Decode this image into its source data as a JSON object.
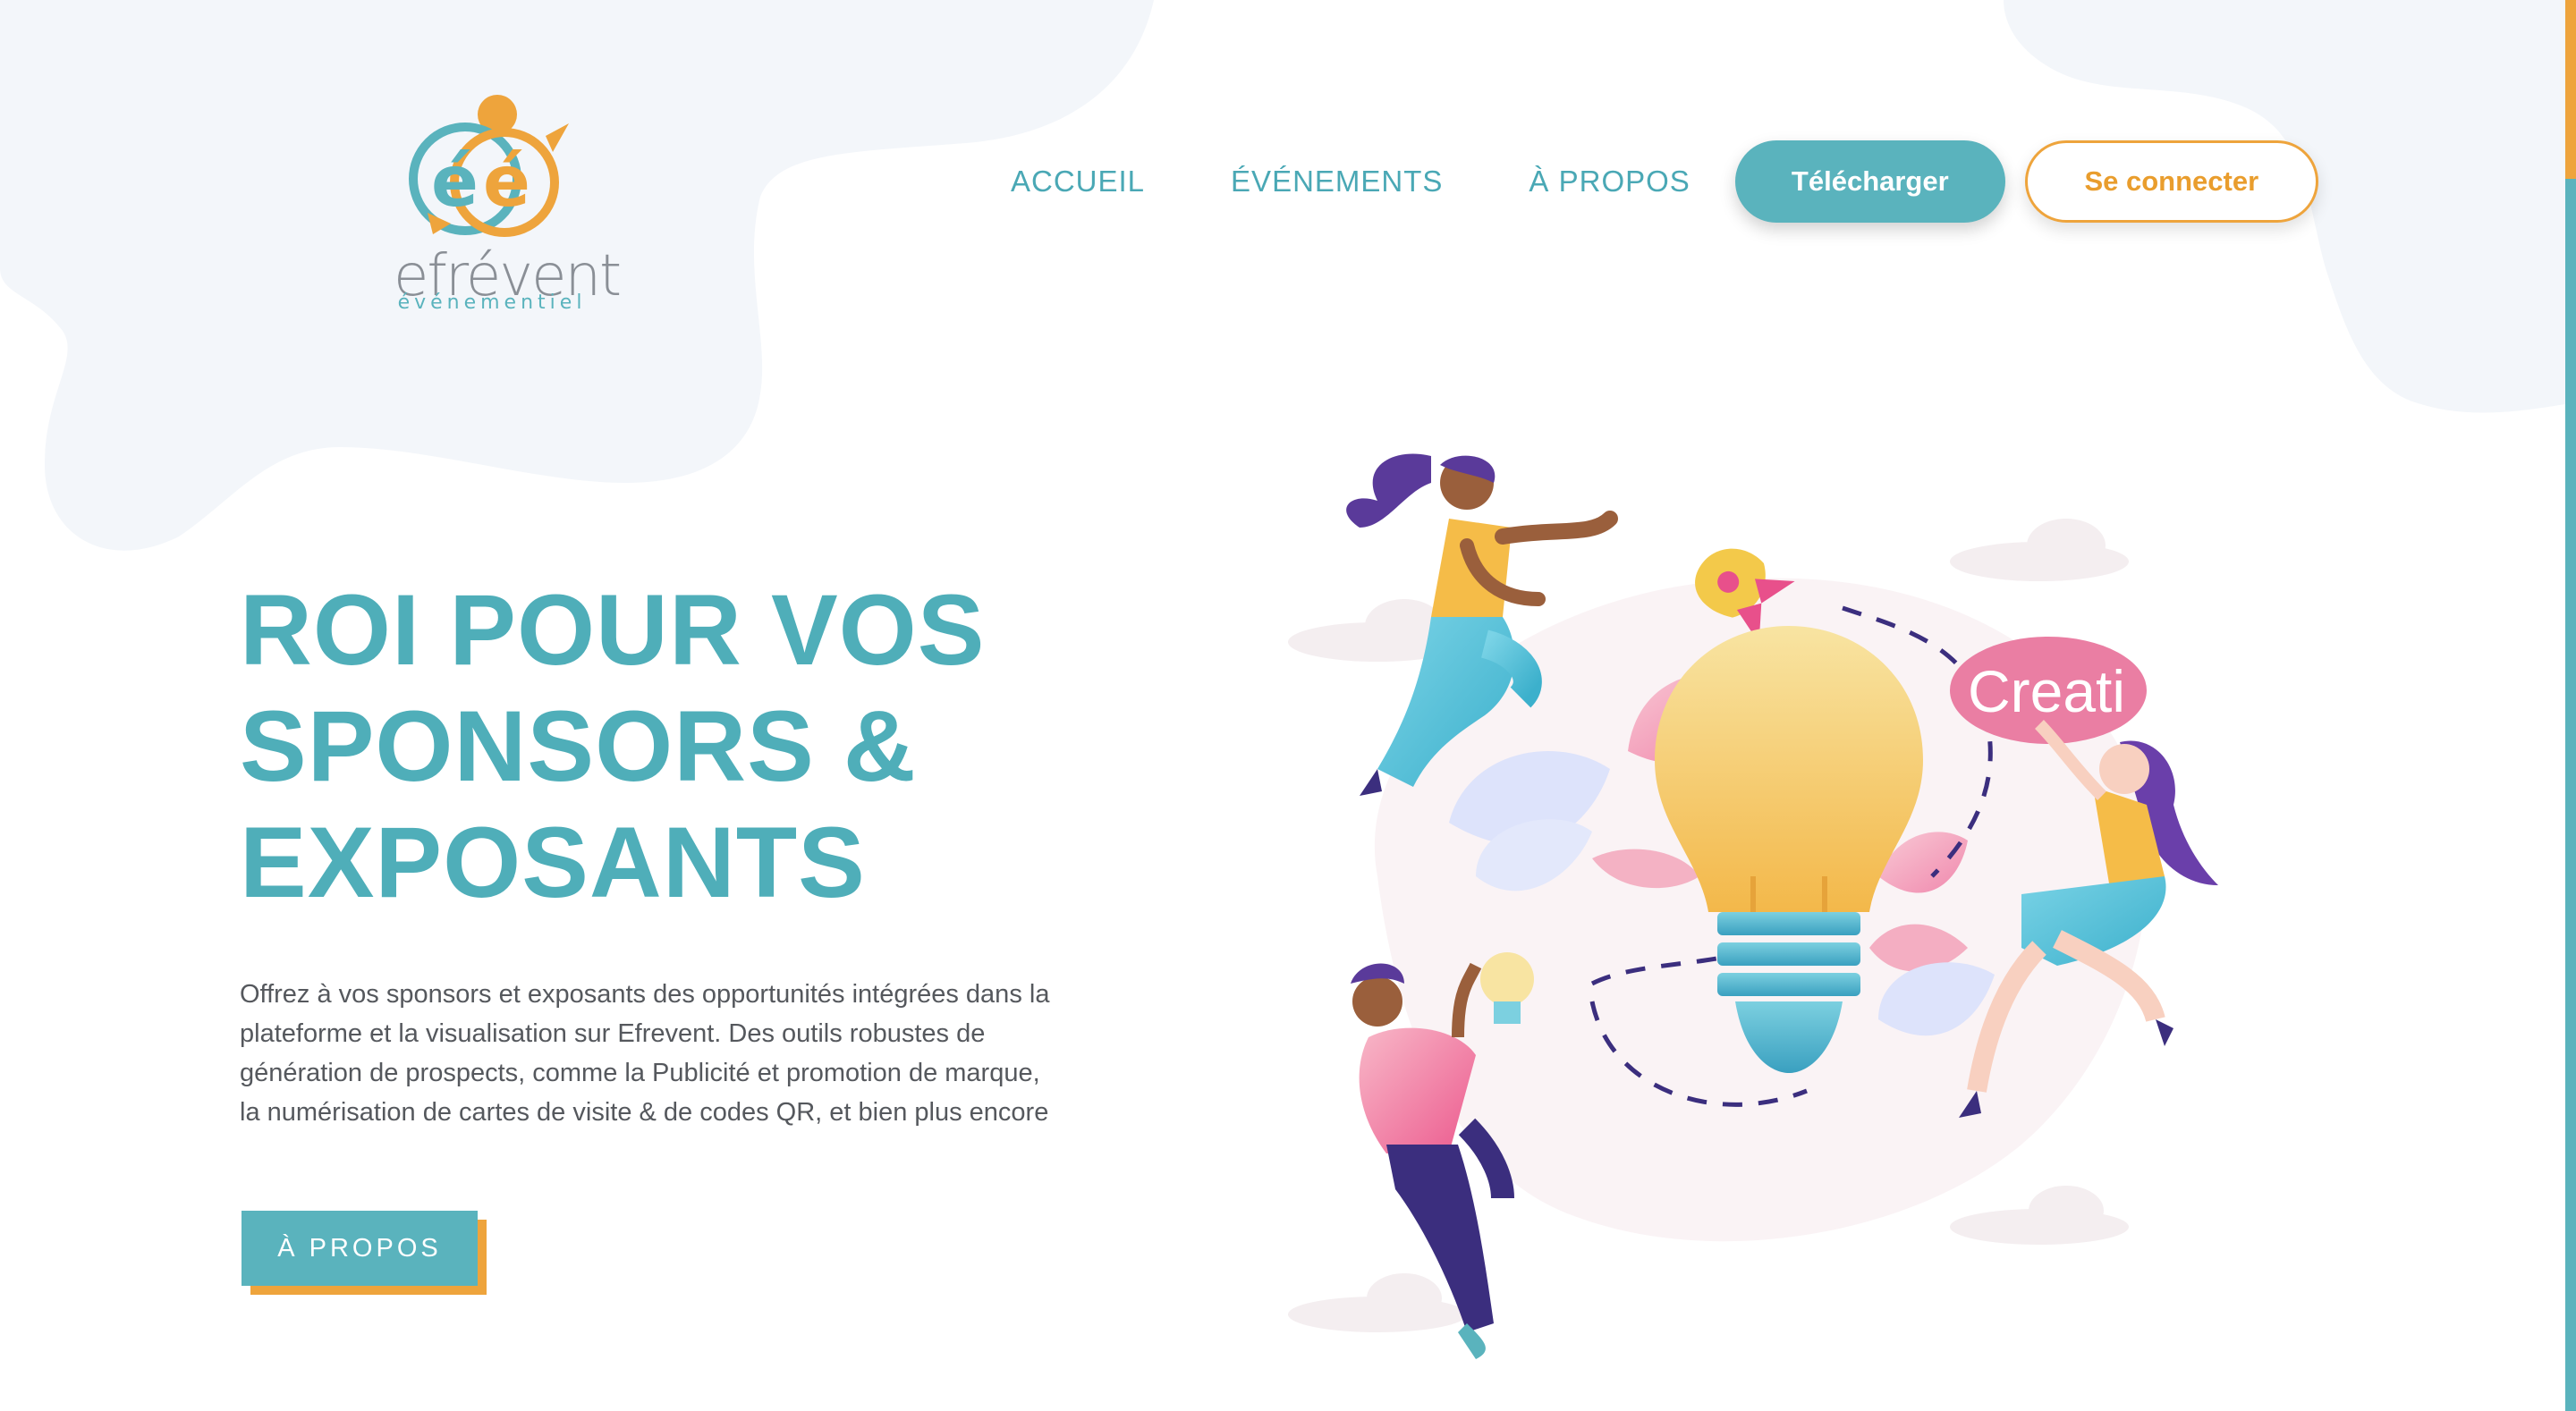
{
  "brand": {
    "name": "efrévent",
    "tagline": "événementiel",
    "colors": {
      "teal": "#5ab3bd",
      "orange": "#eea43c",
      "text": "#55585d",
      "blob": "#f3f6fa"
    }
  },
  "nav": {
    "items": [
      {
        "label": "ACCUEIL"
      },
      {
        "label": "ÉVÉNEMENTS"
      },
      {
        "label": "À PROPOS"
      }
    ],
    "download_label": "Télécharger",
    "login_label": "Se connecter"
  },
  "hero": {
    "title_lines": [
      "ROI POUR VOS",
      "SPONSORS &",
      "EXPOSANTS"
    ],
    "description": "Offrez à vos sponsors et exposants des opportunités intégrées dans la plateforme et la visualisation sur Efrevent. Des outils robustes de génération de prospects, comme la Publicité et promotion de marque, la numérisation de cartes de visite & de codes QR, et bien plus encore",
    "cta_label": "À PROPOS"
  },
  "illustration": {
    "bubble_text": "Creati",
    "icons": [
      "lightbulb-icon",
      "rocket-icon",
      "cloud-icon",
      "leaf-icon"
    ]
  }
}
